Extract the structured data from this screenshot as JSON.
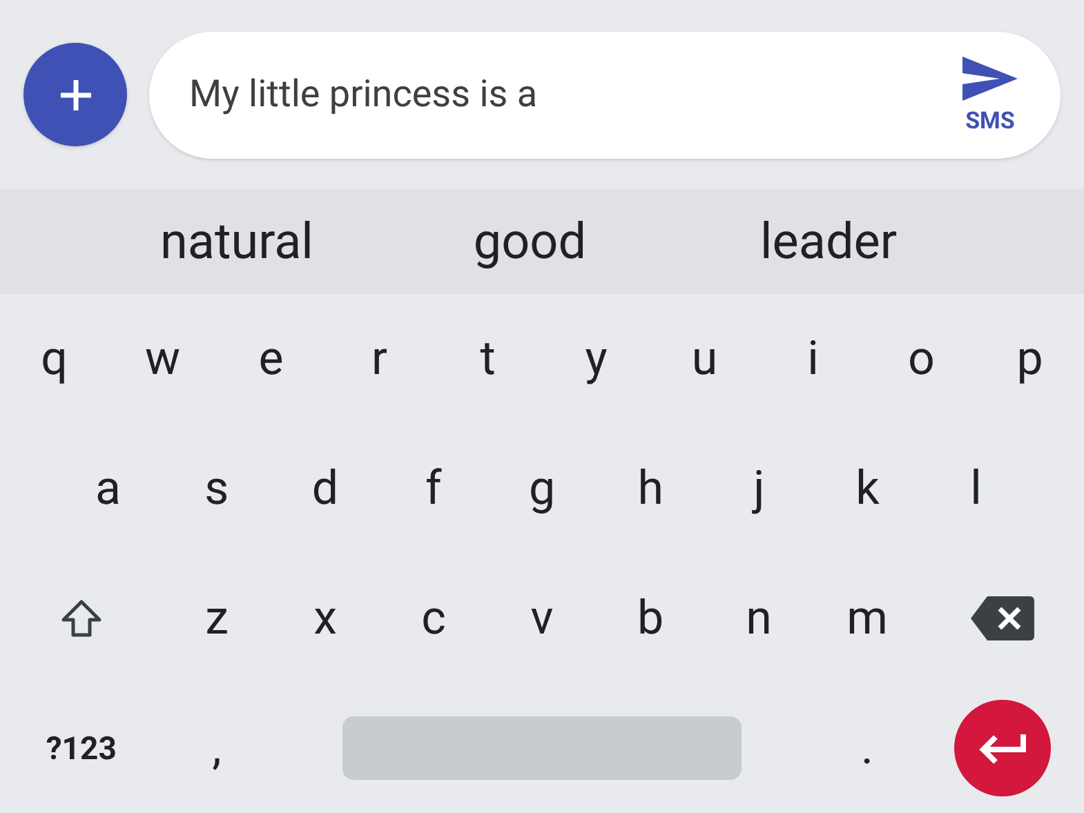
{
  "compose": {
    "text": "My little princess is a",
    "send_label": "SMS"
  },
  "suggestions": [
    "natural",
    "good",
    "leader"
  ],
  "keyboard": {
    "rows": [
      {
        "keys": [
          {
            "kind": "letter",
            "label": "q"
          },
          {
            "kind": "letter",
            "label": "w"
          },
          {
            "kind": "letter",
            "label": "e"
          },
          {
            "kind": "letter",
            "label": "r"
          },
          {
            "kind": "letter",
            "label": "t"
          },
          {
            "kind": "letter",
            "label": "y"
          },
          {
            "kind": "letter",
            "label": "u"
          },
          {
            "kind": "letter",
            "label": "i"
          },
          {
            "kind": "letter",
            "label": "o"
          },
          {
            "kind": "letter",
            "label": "p"
          }
        ]
      },
      {
        "keys": [
          {
            "kind": "letter",
            "label": "a"
          },
          {
            "kind": "letter",
            "label": "s"
          },
          {
            "kind": "letter",
            "label": "d"
          },
          {
            "kind": "letter",
            "label": "f"
          },
          {
            "kind": "letter",
            "label": "g"
          },
          {
            "kind": "letter",
            "label": "h"
          },
          {
            "kind": "letter",
            "label": "j"
          },
          {
            "kind": "letter",
            "label": "k"
          },
          {
            "kind": "letter",
            "label": "l"
          }
        ]
      },
      {
        "keys": [
          {
            "kind": "shift"
          },
          {
            "kind": "letter",
            "label": "z"
          },
          {
            "kind": "letter",
            "label": "x"
          },
          {
            "kind": "letter",
            "label": "c"
          },
          {
            "kind": "letter",
            "label": "v"
          },
          {
            "kind": "letter",
            "label": "b"
          },
          {
            "kind": "letter",
            "label": "n"
          },
          {
            "kind": "letter",
            "label": "m"
          },
          {
            "kind": "backspace"
          }
        ]
      },
      {
        "keys": [
          {
            "kind": "symbols",
            "label": "?123"
          },
          {
            "kind": "letter",
            "label": ","
          },
          {
            "kind": "space"
          },
          {
            "kind": "letter",
            "label": "."
          },
          {
            "kind": "enter"
          }
        ]
      }
    ]
  }
}
